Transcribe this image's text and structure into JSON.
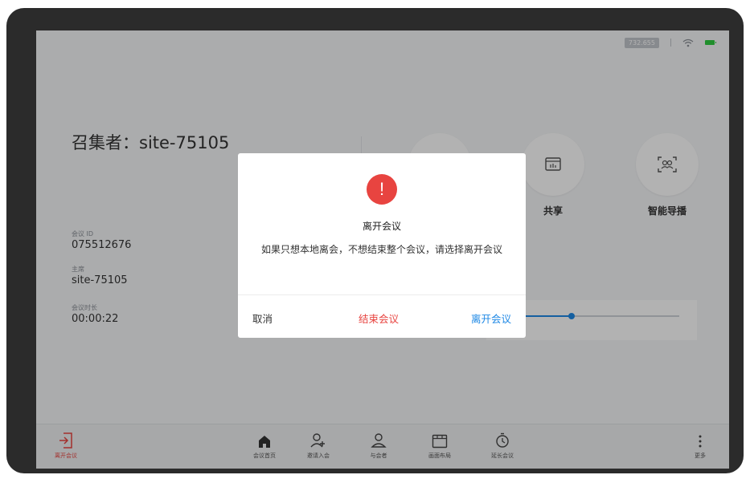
{
  "status_bar": {
    "ip": "732.655"
  },
  "meeting": {
    "convener": "召集者：site-75105",
    "id_label": "会议 ID",
    "id_value": "075512676",
    "host_label": "主席",
    "host_value": "site-75105",
    "duration_label": "会议时长",
    "duration_value": "00:00:22"
  },
  "functions": [
    {
      "icon": "mute-icon",
      "label": ""
    },
    {
      "icon": "share-icon",
      "label": "共享"
    },
    {
      "icon": "smart-director-icon",
      "label": "智能导播"
    }
  ],
  "volume": {
    "level": 0.33,
    "accent": "#1e88e5"
  },
  "toolbar": {
    "leave": {
      "icon": "exit-icon",
      "label": "离开会议",
      "color": "#e84440"
    },
    "items": [
      {
        "icon": "home-icon",
        "label": "会议首页"
      },
      {
        "icon": "invite-icon",
        "label": "邀请入会"
      },
      {
        "icon": "participants-icon",
        "label": "与会者"
      },
      {
        "icon": "layout-icon",
        "label": "画面布局"
      },
      {
        "icon": "extend-icon",
        "label": "延长会议"
      }
    ],
    "more": {
      "icon": "more-icon",
      "label": "更多"
    }
  },
  "dialog": {
    "icon": "alert-icon",
    "icon_glyph": "!",
    "title": "离开会议",
    "message": "如果只想本地离会，不想结束整个会议，请选择离开会议",
    "cancel_label": "取消",
    "end_label": "结束会议",
    "leave_label": "离开会议",
    "colors": {
      "end": "#e84440",
      "leave": "#1e88e5"
    }
  }
}
